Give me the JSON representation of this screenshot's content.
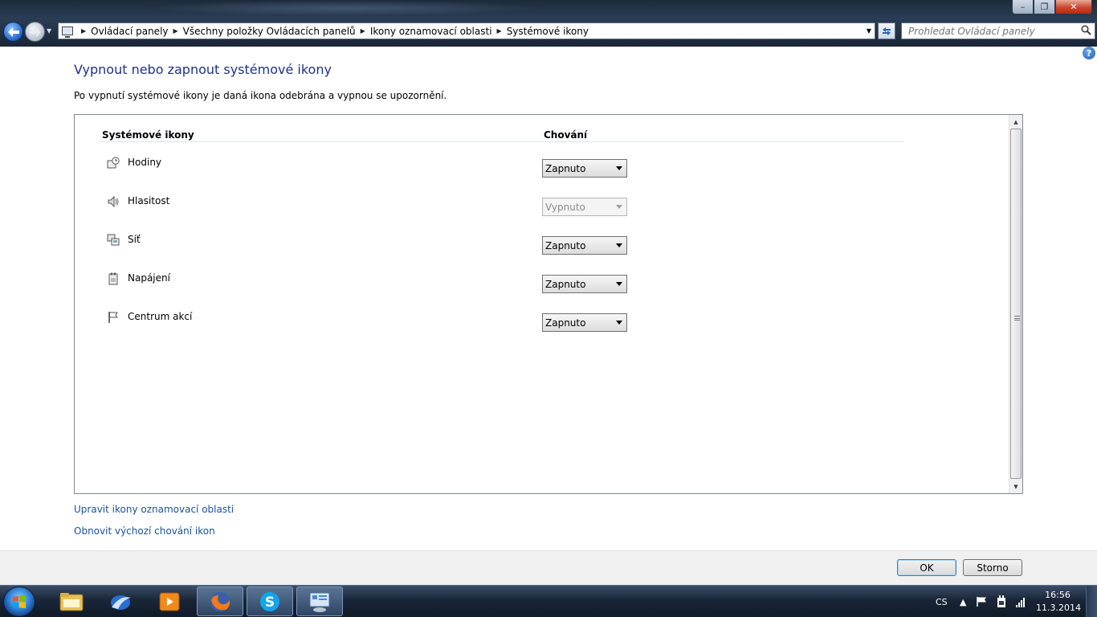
{
  "window": {
    "min_label": "–",
    "max_label": "❐",
    "close_label": "✕"
  },
  "address": {
    "crumbs": [
      "Ovládací panely",
      "Všechny položky Ovládacích panelů",
      "Ikony oznamovací oblasti",
      "Systémové ikony"
    ]
  },
  "search": {
    "placeholder": "Prohledat Ovládací panely"
  },
  "help_label": "?",
  "page": {
    "title": "Vypnout nebo zapnout systémové ikony",
    "description": "Po vypnutí systémové ikony je daná ikona odebrána a vypnou se upozornění."
  },
  "table": {
    "col_icons": "Systémové ikony",
    "col_behavior": "Chování",
    "rows": [
      {
        "label": "Hodiny",
        "value": "Zapnuto",
        "icon": "clock-icon",
        "enabled": true
      },
      {
        "label": "Hlasitost",
        "value": "Vypnuto",
        "icon": "speaker-icon",
        "enabled": false
      },
      {
        "label": "Síť",
        "value": "Zapnuto",
        "icon": "network-icon",
        "enabled": true
      },
      {
        "label": "Napájení",
        "value": "Zapnuto",
        "icon": "power-icon",
        "enabled": true
      },
      {
        "label": "Centrum akcí",
        "value": "Zapnuto",
        "icon": "flag-icon",
        "enabled": true
      }
    ]
  },
  "links": {
    "customize": "Upravit ikony oznamovací oblasti",
    "restore": "Obnovit výchozí chování ikon"
  },
  "buttons": {
    "ok": "OK",
    "cancel": "Storno"
  },
  "taskbar": {
    "lang": "CS",
    "time": "16:56",
    "date": "11.3.2014",
    "apps": [
      "explorer-icon",
      "thunderbird-icon",
      "media-player-icon",
      "firefox-icon",
      "skype-icon",
      "control-panel-icon"
    ]
  }
}
